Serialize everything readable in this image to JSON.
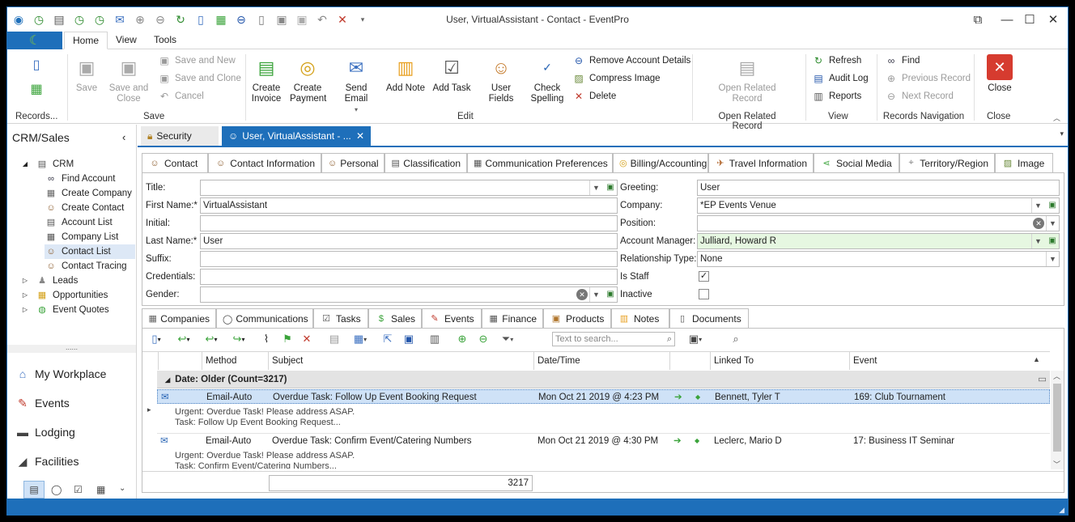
{
  "window": {
    "title": "User, VirtualAssistant - Contact - EventPro",
    "controls": {
      "restore": "⧉",
      "minimize": "—",
      "maximize": "☐",
      "close": "✕"
    }
  },
  "quick_access": {
    "icons": [
      "eventpro-logo-icon",
      "clock-icon",
      "clock-icon",
      "clock-icon",
      "clock-icon",
      "mail-icon",
      "up-circle-icon",
      "down-circle-icon",
      "refresh-icon",
      "new-page-icon",
      "green-cubes-icon",
      "remove-icon",
      "document-icon",
      "save-icon",
      "save-disabled-icon",
      "undo-icon",
      "close-x-icon",
      "customize-icon"
    ]
  },
  "ribbon": {
    "tabs": [
      "Home",
      "View",
      "Tools"
    ],
    "groups": {
      "records": "Records...",
      "save": "Save",
      "edit": "Edit",
      "open_related": "Open Related Record",
      "view": "View",
      "nav": "Records Navigation",
      "close": "Close"
    },
    "save": {
      "save": "Save",
      "save_and_close": "Save and Close",
      "save_and_new": "Save and New",
      "save_and_clone": "Save and Clone",
      "cancel": "Cancel"
    },
    "edit": {
      "create_invoice": "Create Invoice",
      "create_payment": "Create Payment",
      "send_email": "Send Email",
      "add_note": "Add Note",
      "add_task": "Add Task",
      "user_fields": "User Fields",
      "check_spelling": "Check Spelling",
      "remove_account_details": "Remove Account Details",
      "compress_image": "Compress Image",
      "delete": "Delete"
    },
    "open_related_record": "Open Related Record",
    "view": {
      "refresh": "Refresh",
      "audit_log": "Audit Log",
      "reports": "Reports"
    },
    "nav": {
      "find": "Find",
      "previous_record": "Previous Record",
      "next_record": "Next Record"
    },
    "close": "Close"
  },
  "left_nav": {
    "header": "CRM/Sales",
    "tree": {
      "crm": "CRM",
      "children": [
        "Find Account",
        "Create Company",
        "Create Contact",
        "Account List",
        "Company List",
        "Contact List",
        "Contact Tracing"
      ],
      "leads": "Leads",
      "opportunities": "Opportunities",
      "event_quotes": "Event Quotes"
    },
    "dots": "......",
    "sections": [
      "My Workplace",
      "Events",
      "Lodging",
      "Facilities"
    ]
  },
  "doc_tabs": [
    "Security",
    "User, VirtualAssistant - ..."
  ],
  "form_tabs": [
    "Contact",
    "Contact Information",
    "Personal",
    "Classification",
    "Communication Preferences",
    "Billing/Accounting",
    "Travel Information",
    "Social Media",
    "Territory/Region",
    "Image"
  ],
  "contact_form": {
    "labels_left": [
      "Title:",
      "First Name:*",
      "Initial:",
      "Last Name:*",
      "Suffix:",
      "Credentials:",
      "Gender:"
    ],
    "values_left": {
      "title": "",
      "first_name": "VirtualAssistant",
      "initial": "",
      "last_name": "User",
      "suffix": "",
      "credentials": "",
      "gender": ""
    },
    "labels_right": [
      "Greeting:",
      "Company:",
      "Position:",
      "Account Manager:",
      "Relationship Type:",
      "Is Staff",
      "Inactive"
    ],
    "values_right": {
      "greeting": "User",
      "company": "*EP Events Venue",
      "position": "",
      "account_manager": "Julliard, Howard R",
      "relationship_type": "None"
    },
    "is_staff": true,
    "inactive": false
  },
  "sub_tabs": [
    "Companies",
    "Communications",
    "Tasks",
    "Sales",
    "Events",
    "Finance",
    "Products",
    "Notes",
    "Documents"
  ],
  "grid": {
    "search_placeholder": "Text to search...",
    "columns": [
      "Method",
      "Subject",
      "Date/Time",
      "Linked To",
      "Event"
    ],
    "group_header": "Date: Older (Count=3217)",
    "rows": [
      {
        "method": "Email-Auto",
        "subject": "Overdue Task: Follow Up Event Booking Request",
        "datetime": "Mon Oct 21 2019 @ 4:23 PM",
        "linked_to": "Bennett, Tyler T",
        "event": "169: Club Tournament",
        "preview": [
          "Urgent: Overdue Task! Please address ASAP.",
          "Task: Follow Up Event Booking Request..."
        ]
      },
      {
        "method": "Email-Auto",
        "subject": "Overdue Task: Confirm Event/Catering Numbers",
        "datetime": "Mon Oct 21 2019 @ 4:30 PM",
        "linked_to": "Leclerc, Mario D",
        "event": "17: Business IT Seminar",
        "preview": [
          "Urgent: Overdue Task! Please address ASAP.",
          "Task: Confirm Event/Catering Numbers..."
        ]
      }
    ],
    "footer_count": "3217"
  },
  "colors": {
    "accent": "#1e6fba",
    "selected_row": "#cfe2f7",
    "highlight_field": "#e6f7e1"
  }
}
